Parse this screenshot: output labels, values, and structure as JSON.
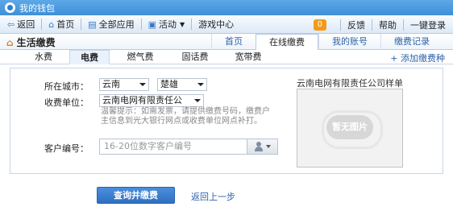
{
  "window": {
    "title": "我的钱包"
  },
  "toolbar": {
    "back": "返回",
    "home": "首页",
    "all_apps": "全部应用",
    "activity": "活动",
    "game_center": "游戏中心",
    "badge_count": "0",
    "feedback": "反馈",
    "help": "帮助",
    "one_click_login": "一键登录"
  },
  "header": {
    "title": "生活缴费",
    "tabs": [
      "首页",
      "在线缴费",
      "我的账号",
      "缴费记录"
    ],
    "active_tab": "在线缴费"
  },
  "subtabs": {
    "items": [
      "水费",
      "电费",
      "燃气费",
      "固话费",
      "宽带费"
    ],
    "active": "电费",
    "add_label": "+ 添加缴费种"
  },
  "form": {
    "city_label": "所在城市：",
    "province": "云南",
    "city": "楚雄",
    "unit_label": "收费单位：",
    "unit": "云南电网有限责任公",
    "hint": "温馨提示：如需发票，请提供缴费号码，缴费户主信息到光大银行网点或收费单位网点补打。",
    "customer_label": "客户编号：",
    "customer_placeholder": "16-20位数字客户编号"
  },
  "sample": {
    "title": "云南电网有限责任公司样单",
    "no_image": "暂无图片"
  },
  "actions": {
    "query_pay": "查询并缴费",
    "back_prev": "返回上一步"
  },
  "colors": {
    "titlebar": "#3f8fd8",
    "primary_button": "#2f6fc0",
    "link": "#2d63a8",
    "badge": "#f19a1c"
  }
}
